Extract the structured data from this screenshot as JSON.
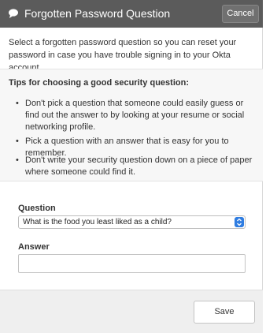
{
  "header": {
    "title": "Forgotten Password Question",
    "cancel_label": "Cancel",
    "icon": "speech-bubble-icon"
  },
  "intro": "Select a forgotten password question so you can reset your password in case you have trouble signing in to your Okta account.",
  "tips": {
    "heading": "Tips for choosing a good security question:",
    "items": [
      "Don't pick a question that someone could easily guess or find out the answer to by looking at your resume or social networking profile.",
      "Pick a question with an answer that is easy for you to remember.",
      "Don't write your security question down on a piece of paper where someone could find it."
    ]
  },
  "form": {
    "question_label": "Question",
    "question_selected": "What is the food you least liked as a child?",
    "answer_label": "Answer",
    "answer_value": ""
  },
  "footer": {
    "save_label": "Save"
  },
  "colors": {
    "header_bg": "#5b5b5b",
    "tips_bg": "#f7f7f7",
    "footer_bg": "#efefef",
    "select_accent": "#2f7de1"
  }
}
